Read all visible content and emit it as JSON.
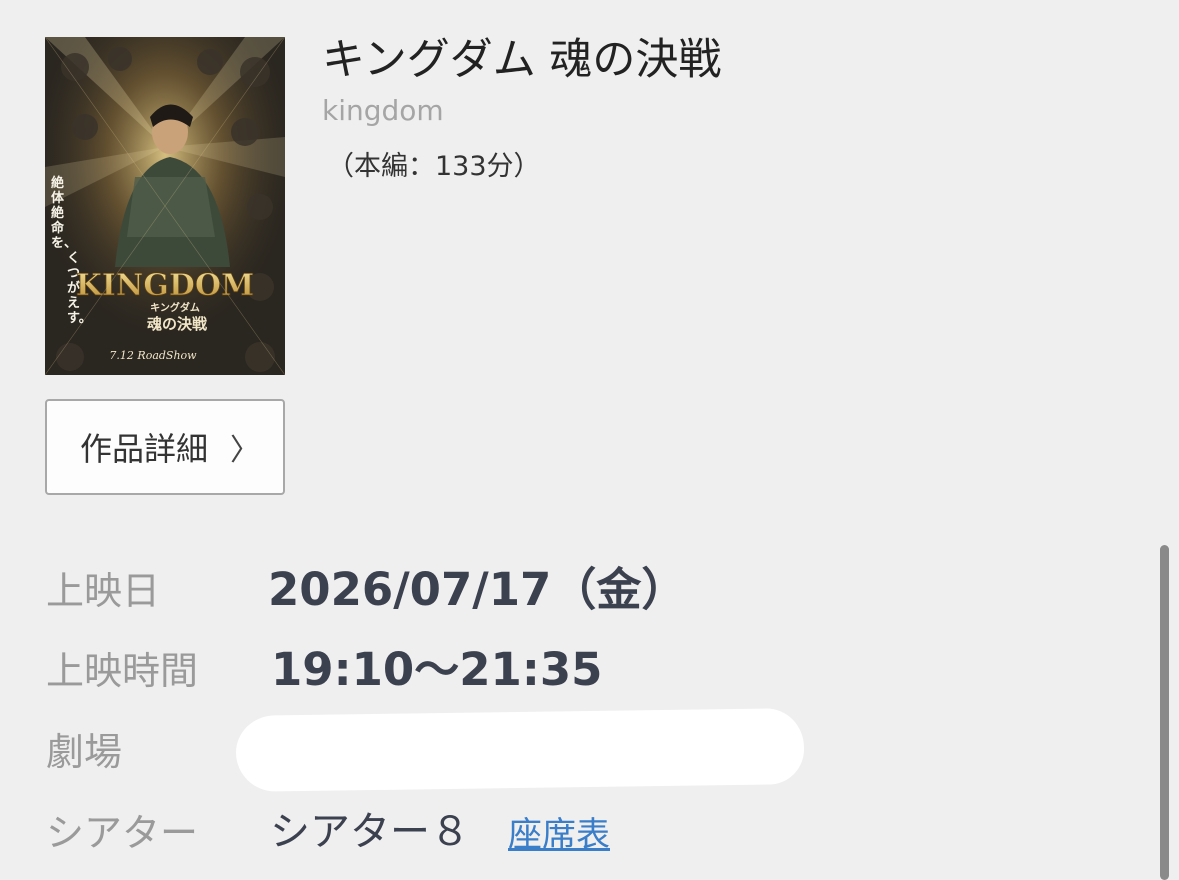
{
  "movie": {
    "title": "キングダム 魂の決戦",
    "subtitle": "kingdom",
    "runtime": "（本編：133分）",
    "poster": {
      "vertical_text": "絶体絶命を、くつがえす。",
      "logo": "KINGDOM",
      "logo_sub": "キングダム",
      "logo_title": "魂の決戦",
      "release": "7.12 RoadShow"
    }
  },
  "detail_button": {
    "label": "作品詳細",
    "chevron": "〉"
  },
  "info": {
    "date_label": "上映日",
    "date_value": "2026/07/17（金）",
    "time_label": "上映時間",
    "time_value": "19:10〜21:35",
    "theater_label": "劇場",
    "screen_label": "シアター",
    "screen_value": "シアター８",
    "seat_map_link": "座席表"
  },
  "colors": {
    "background": "#efefef",
    "link": "#3a7dc9",
    "value_text": "#3c4150",
    "label_text": "#9a9a9a"
  }
}
